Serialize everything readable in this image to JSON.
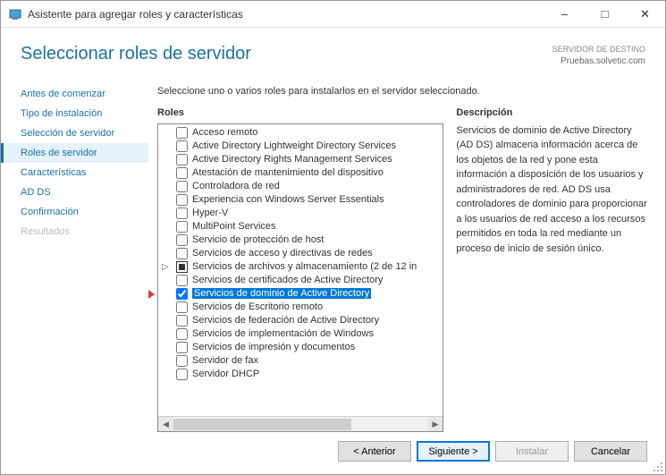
{
  "window": {
    "title": "Asistente para agregar roles y características"
  },
  "header": {
    "page_title": "Seleccionar roles de servidor",
    "dest_label": "SERVIDOR DE DESTINO",
    "dest_value": "Pruebas.solvetic.com"
  },
  "nav": {
    "items": [
      {
        "label": "Antes de comenzar",
        "state": "normal"
      },
      {
        "label": "Tipo de instalación",
        "state": "normal"
      },
      {
        "label": "Selección de servidor",
        "state": "normal"
      },
      {
        "label": "Roles de servidor",
        "state": "active"
      },
      {
        "label": "Características",
        "state": "normal"
      },
      {
        "label": "AD DS",
        "state": "normal"
      },
      {
        "label": "Confirmación",
        "state": "normal"
      },
      {
        "label": "Resultados",
        "state": "disabled"
      }
    ]
  },
  "main": {
    "instruction": "Seleccione uno o varios roles para instalarlos en el servidor seleccionado.",
    "roles_header": "Roles",
    "desc_header": "Descripción",
    "roles": [
      {
        "label": "Acceso remoto",
        "checked": false
      },
      {
        "label": "Active Directory Lightweight Directory Services",
        "checked": false
      },
      {
        "label": "Active Directory Rights Management Services",
        "checked": false
      },
      {
        "label": "Atestación de mantenimiento del dispositivo",
        "checked": false
      },
      {
        "label": "Controladora de red",
        "checked": false
      },
      {
        "label": "Experiencia con Windows Server Essentials",
        "checked": false
      },
      {
        "label": "Hyper-V",
        "checked": false
      },
      {
        "label": "MultiPoint Services",
        "checked": false
      },
      {
        "label": "Servicio de protección de host",
        "checked": false
      },
      {
        "label": "Servicios de acceso y directivas de redes",
        "checked": false
      },
      {
        "label": "Servicios de archivos y almacenamiento (2 de 12 in",
        "mixed": true,
        "expandable": true
      },
      {
        "label": "Servicios de certificados de Active Directory",
        "checked": false
      },
      {
        "label": "Servicios de dominio de Active Directory",
        "checked": true,
        "selected": true
      },
      {
        "label": "Servicios de Escritorio remoto",
        "checked": false
      },
      {
        "label": "Servicios de federación de Active Directory",
        "checked": false
      },
      {
        "label": "Servicios de implementación de Windows",
        "checked": false
      },
      {
        "label": "Servicios de impresión y documentos",
        "checked": false
      },
      {
        "label": "Servidor de fax",
        "checked": false
      },
      {
        "label": "Servidor DHCP",
        "checked": false
      }
    ],
    "description": "Servicios de dominio de Active Directory (AD DS) almacena información acerca de los objetos de la red y pone esta información a disposición de los usuarios y administradores de red. AD DS usa controladores de dominio para proporcionar a los usuarios de red acceso a los recursos permitidos en toda la red mediante un proceso de inicio de sesión único."
  },
  "footer": {
    "prev": "< Anterior",
    "next": "Siguiente >",
    "install": "Instalar",
    "cancel": "Cancelar"
  }
}
